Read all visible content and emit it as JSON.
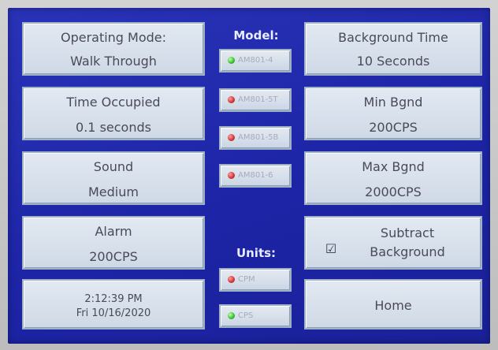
{
  "left_panels": {
    "operating_mode": {
      "title": "Operating Mode:",
      "value": "Walk Through"
    },
    "time_occupied": {
      "title": "Time Occupied",
      "value": "0.1 seconds"
    },
    "sound": {
      "title": "Sound",
      "value": "Medium"
    },
    "alarm": {
      "title": "Alarm",
      "value": "200CPS"
    },
    "clock": {
      "time": "2:12:39 PM",
      "date": "Fri 10/16/2020"
    }
  },
  "model": {
    "heading": "Model:",
    "options": [
      {
        "label": "AM801-4",
        "state": "on",
        "indicator": "green-led-icon"
      },
      {
        "label": "AM801-5T",
        "state": "off",
        "indicator": "red-led-icon"
      },
      {
        "label": "AM801-5B",
        "state": "off",
        "indicator": "red-led-icon"
      },
      {
        "label": "AM801-6",
        "state": "off",
        "indicator": "red-led-icon"
      }
    ]
  },
  "units": {
    "heading": "Units:",
    "options": [
      {
        "label": "CPM",
        "state": "off",
        "indicator": "red-led-icon"
      },
      {
        "label": "CPS",
        "state": "on",
        "indicator": "green-led-icon"
      }
    ]
  },
  "right_panels": {
    "background_time": {
      "title": "Background Time",
      "value": "10 Seconds"
    },
    "min_bgnd": {
      "title": "Min Bgnd",
      "value": "200CPS"
    },
    "max_bgnd": {
      "title": "Max Bgnd",
      "value": "2000CPS"
    },
    "subtract_background": {
      "line1": "Subtract",
      "line2": "Background",
      "checked": true,
      "check_glyph": "☑",
      "icon": "checkbox-checked-icon"
    },
    "home": {
      "label": "Home"
    }
  },
  "colors": {
    "screen_blue": "#1d24a6",
    "panel_face": "#d6dfeb",
    "led_on": "#3cc43a",
    "led_off": "#d83a3a"
  }
}
